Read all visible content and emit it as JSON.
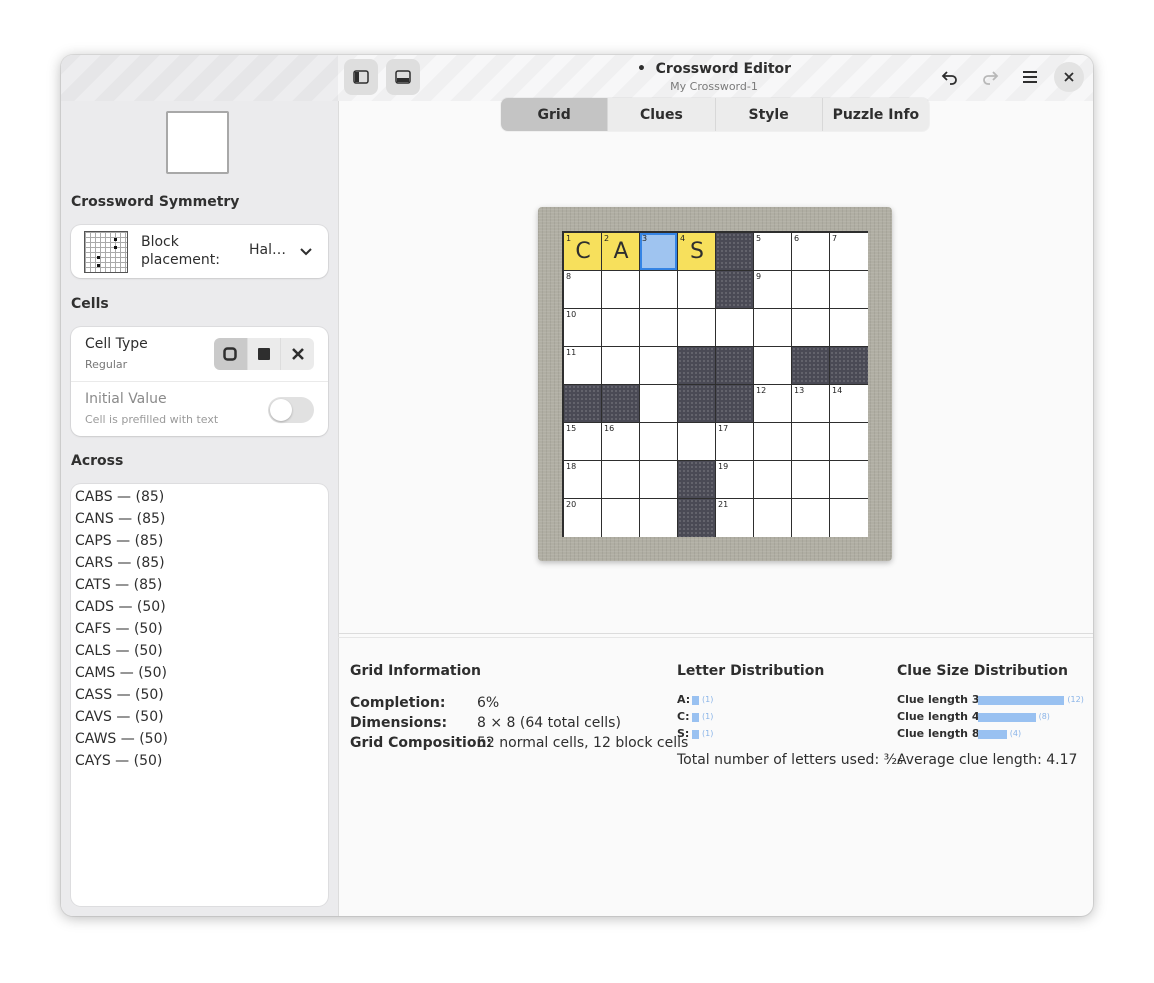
{
  "window": {
    "title": "Crossword Editor",
    "modified_marker": "•",
    "subtitle": "My Crossword-1"
  },
  "header": {
    "tabs": [
      {
        "label": "Grid",
        "active": true
      },
      {
        "label": "Clues",
        "active": false
      },
      {
        "label": "Style",
        "active": false
      },
      {
        "label": "Puzzle Info",
        "active": false
      }
    ],
    "icons": {
      "sidebar_toggle": "sidebar-toggle-icon",
      "bottom_panel": "bottom-panel-icon",
      "undo": "undo-icon",
      "redo": "redo-icon",
      "menu": "menu-icon",
      "close": "close-icon"
    }
  },
  "sidebar": {
    "symmetry_title": "Crossword Symmetry",
    "block_placement_label": "Block placement:",
    "block_placement_value": "Hal…",
    "cells_title": "Cells",
    "cell_type_label": "Cell Type",
    "cell_type_value": "Regular",
    "cell_type_options": [
      "regular-cell-icon",
      "block-cell-icon",
      "null-cell-icon"
    ],
    "initial_value_label": "Initial Value",
    "initial_value_sub": "Cell is prefilled with text",
    "initial_value_on": false,
    "across_title": "Across",
    "across_items": [
      "CABS — (85)",
      "CANS — (85)",
      "CAPS — (85)",
      "CARS — (85)",
      "CATS — (85)",
      "CADS — (50)",
      "CAFS — (50)",
      "CALS — (50)",
      "CAMS — (50)",
      "CASS — (50)",
      "CAVS — (50)",
      "CAWS — (50)",
      "CAYS — (50)"
    ]
  },
  "grid": {
    "size": 8,
    "rows": [
      "CA.S#...",
      "....#...",
      "........",
      "...##.##",
      "##.##...",
      "........",
      "...#....",
      "...#...."
    ],
    "numbers": [
      [
        0,
        0,
        1
      ],
      [
        0,
        1,
        2
      ],
      [
        0,
        2,
        3
      ],
      [
        0,
        3,
        4
      ],
      [
        0,
        5,
        5
      ],
      [
        0,
        6,
        6
      ],
      [
        0,
        7,
        7
      ],
      [
        1,
        0,
        8
      ],
      [
        1,
        5,
        9
      ],
      [
        2,
        0,
        10
      ],
      [
        3,
        0,
        11
      ],
      [
        4,
        5,
        12
      ],
      [
        4,
        6,
        13
      ],
      [
        4,
        7,
        14
      ],
      [
        5,
        0,
        15
      ],
      [
        5,
        1,
        16
      ],
      [
        5,
        4,
        17
      ],
      [
        6,
        0,
        18
      ],
      [
        6,
        4,
        19
      ],
      [
        7,
        0,
        20
      ],
      [
        7,
        4,
        21
      ]
    ],
    "highlighted": [
      [
        0,
        0
      ],
      [
        0,
        1
      ],
      [
        0,
        3
      ]
    ],
    "selected": [
      0,
      2
    ]
  },
  "info": {
    "grid_title": "Grid Information",
    "completion_key": "Completion:",
    "completion_val": "6%",
    "dimensions_key": "Dimensions:",
    "dimensions_val": "8 × 8 (64 total cells)",
    "composition_key": "Grid Composition:",
    "composition_val": "52 normal cells, 12 block cells",
    "letter_title": "Letter Distribution",
    "letters": [
      {
        "key": "A:",
        "count": 1,
        "count_label": "(1)"
      },
      {
        "key": "C:",
        "count": 1,
        "count_label": "(1)"
      },
      {
        "key": "S:",
        "count": 1,
        "count_label": "(1)"
      }
    ],
    "letters_total": "Total number of letters used: ³⁄₂₆",
    "clue_title": "Clue Size Distribution",
    "clue_sizes": [
      {
        "key": "Clue length 3:",
        "count": 12,
        "count_label": "(12)"
      },
      {
        "key": "Clue length 4:",
        "count": 8,
        "count_label": "(8)"
      },
      {
        "key": "Clue length 8:",
        "count": 4,
        "count_label": "(4)"
      }
    ],
    "clue_average": "Average clue length: 4.17"
  },
  "colors": {
    "highlight": "#f7e05c",
    "selected": "#9fc4f0",
    "block": "#4a4a55",
    "bar": "#99c1f1"
  }
}
